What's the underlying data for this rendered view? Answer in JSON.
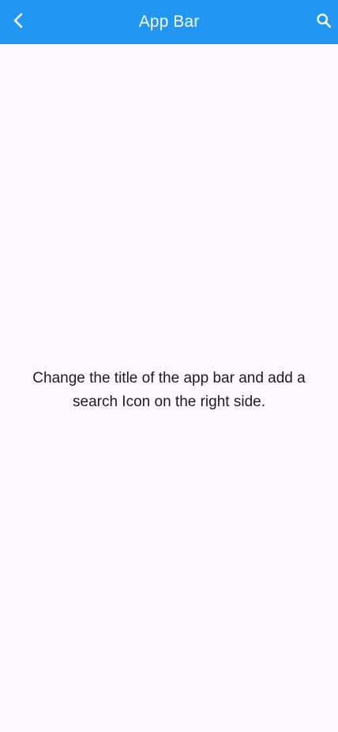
{
  "app_bar": {
    "title": "App Bar",
    "background": "#2196f3",
    "back_icon": "chevron-left-icon",
    "action_icon": "search-icon"
  },
  "body": {
    "message": "Change the title of the app bar and add a search Icon on the right side.",
    "background": "#fdf7fe"
  }
}
